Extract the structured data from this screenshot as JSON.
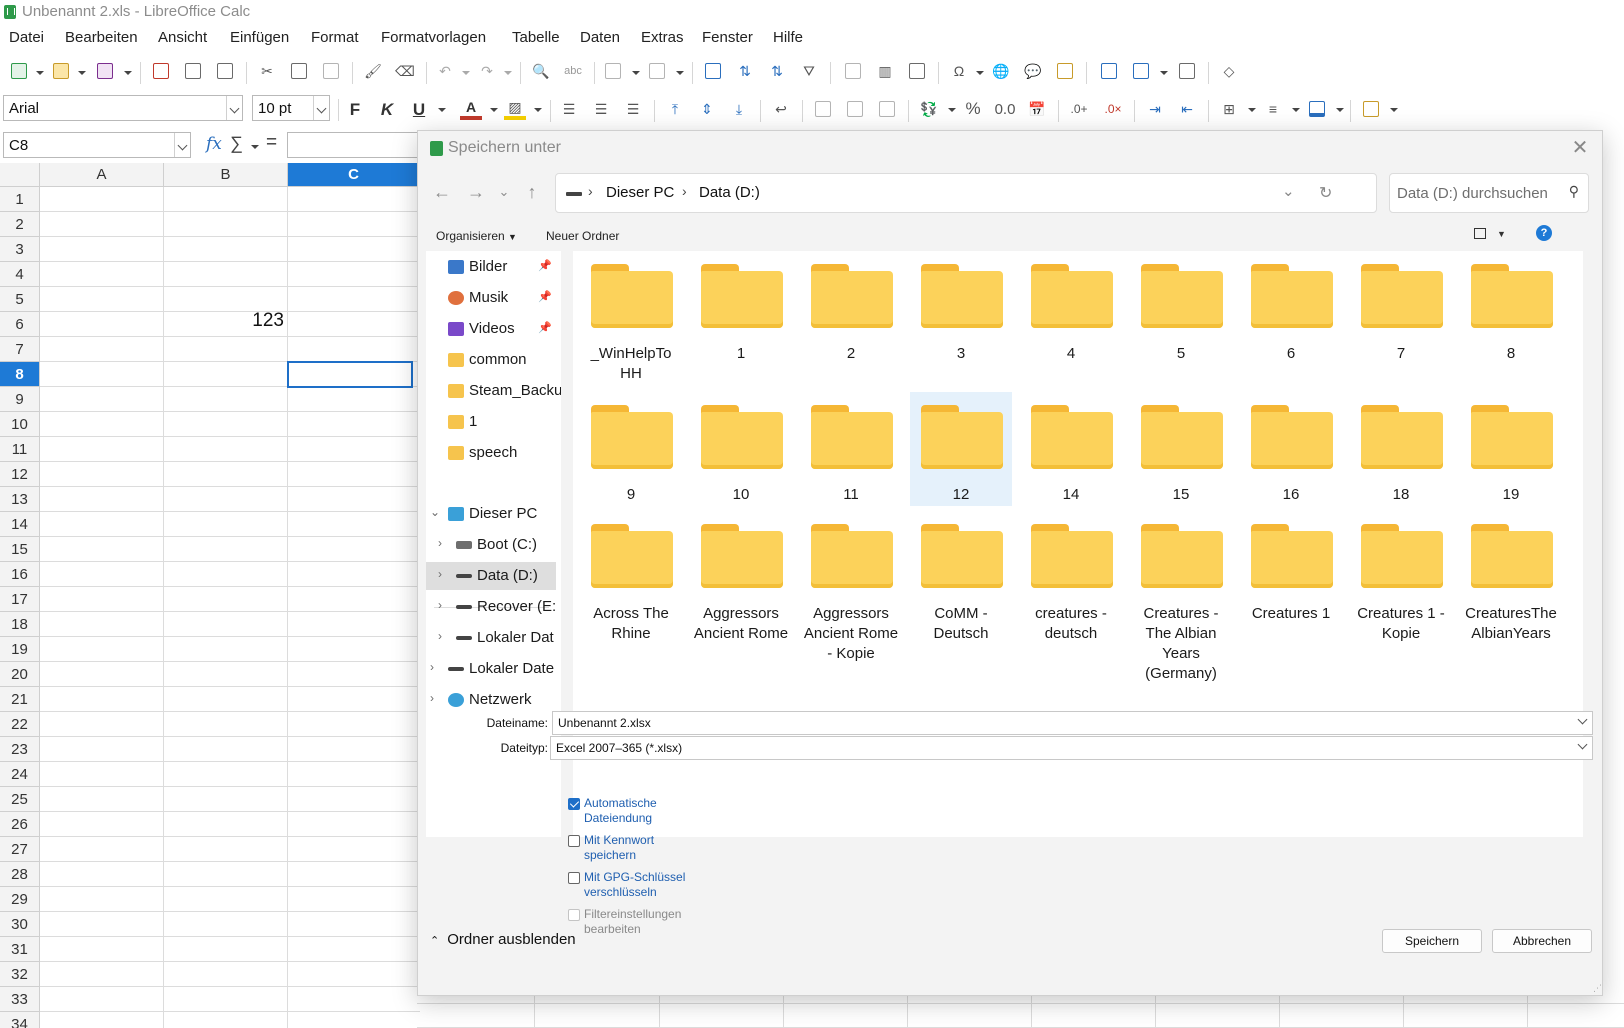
{
  "window": {
    "title": "Unbenannt 2.xls - LibreOffice Calc"
  },
  "menu": [
    "Datei",
    "Bearbeiten",
    "Ansicht",
    "Einfügen",
    "Format",
    "Formatvorlagen",
    "Tabelle",
    "Daten",
    "Extras",
    "Fenster",
    "Hilfe"
  ],
  "format_bar": {
    "font_name": "Arial",
    "font_size": "10 pt",
    "bold": "F",
    "italic": "K",
    "underline": "U"
  },
  "formula_bar": {
    "name_box": "C8",
    "fx": "fx",
    "sum": "∑",
    "equals": "="
  },
  "sheet": {
    "columns": [
      "A",
      "B",
      "C"
    ],
    "selected_column": "C",
    "rows": [
      "1",
      "2",
      "3",
      "4",
      "5",
      "6",
      "7",
      "8",
      "9",
      "10",
      "11",
      "12",
      "13",
      "14",
      "15",
      "16",
      "17",
      "18",
      "19",
      "20",
      "21",
      "22",
      "23",
      "24",
      "25",
      "26",
      "27",
      "28",
      "29",
      "30",
      "31",
      "32",
      "33",
      "34"
    ],
    "selected_row": "8",
    "cell_b6": "123",
    "active_cell": "C8"
  },
  "dialog": {
    "title": "Speichern unter",
    "close": "✕",
    "breadcrumb": [
      "Dieser PC",
      "Data (D:)"
    ],
    "search_placeholder": "Data (D:) durchsuchen",
    "organize": "Organisieren",
    "new_folder": "Neuer Ordner",
    "help": "?",
    "nav_quick": [
      "Bilder",
      "Musik",
      "Videos",
      "common",
      "Steam_Backu",
      "1",
      "speech"
    ],
    "nav_tree": [
      "Dieser PC",
      "Boot (C:)",
      "Data (D:)",
      "Recover (E:",
      "Lokaler Dat",
      "Lokaler Date",
      "Netzwerk"
    ],
    "nav_selected": "Data (D:)",
    "folders": [
      [
        "_WinHelpTo HH",
        "1",
        "2",
        "3",
        "4",
        "5",
        "6",
        "7",
        "8"
      ],
      [
        "9",
        "10",
        "11",
        "12",
        "14",
        "15",
        "16",
        "18",
        "19"
      ],
      [
        "Across The Rhine",
        "Aggressors Ancient Rome",
        "Aggressors Ancient Rome - Kopie",
        "CoMM - Deutsch",
        "creatures - deutsch",
        "Creatures - The Albian Years (Germany)",
        "Creatures 1",
        "Creatures 1 - Kopie",
        "CreaturesThe AlbianYears"
      ]
    ],
    "selected_folder": "12",
    "filename_label": "Dateiname:",
    "filename_value": "Unbenannt 2.xlsx",
    "filetype_label": "Dateityp:",
    "filetype_value": "Excel 2007–365 (*.xlsx)",
    "options": [
      {
        "label": "Automatische Dateiendung",
        "checked": true,
        "enabled": true
      },
      {
        "label": "Mit Kennwort speichern",
        "checked": false,
        "enabled": true
      },
      {
        "label": "Mit GPG-Schlüssel verschlüsseln",
        "checked": false,
        "enabled": true
      },
      {
        "label": "Filtereinstellungen bearbeiten",
        "checked": false,
        "enabled": false
      }
    ],
    "hide_folders": "Ordner ausblenden",
    "save": "Speichern",
    "cancel": "Abbrechen"
  },
  "colors": {
    "accent": "#1e7ad6",
    "folder": "#fcd25a",
    "folder_tab": "#f5b735",
    "selection": "#e5f1fb"
  }
}
